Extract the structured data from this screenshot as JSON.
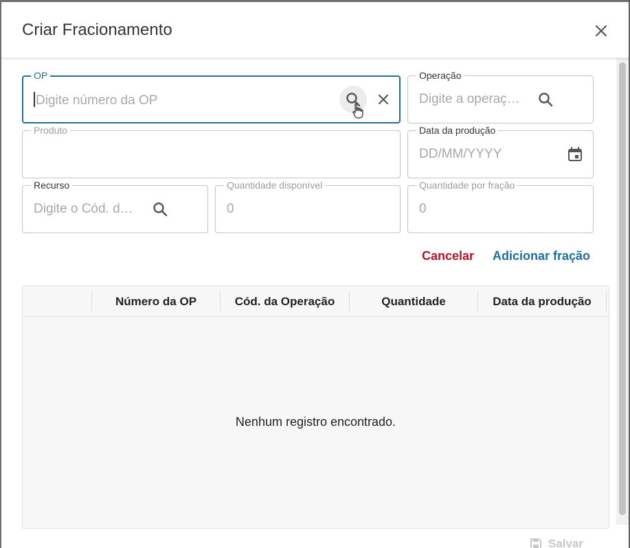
{
  "dialog": {
    "title": "Criar Fracionamento"
  },
  "form": {
    "op": {
      "label": "OP",
      "placeholder": "Digite número da OP"
    },
    "operacao": {
      "label": "Operação",
      "placeholder": "Digite a operaç…"
    },
    "produto": {
      "label": "Produto",
      "value": ""
    },
    "data_producao": {
      "label": "Data da produção",
      "placeholder": "DD/MM/YYYY"
    },
    "recurso": {
      "label": "Recurso",
      "placeholder": "Digite o Cód. d…"
    },
    "quantidade_disponivel": {
      "label": "Quantidade disponível",
      "value": "0"
    },
    "quantidade_por_fracao": {
      "label": "Quantidade por fração",
      "value": "0"
    }
  },
  "actions": {
    "cancel_label": "Cancelar",
    "add_label": "Adicionar fração"
  },
  "table": {
    "columns": [
      "",
      "Número da OP",
      "Cód. da Operação",
      "Quantidade",
      "Data da produção"
    ],
    "empty_message": "Nenhum registro encontrado."
  },
  "footer": {
    "save_label": "Salvar"
  },
  "colors": {
    "primary": "#1f6e9c",
    "danger": "#b3132b",
    "border": "#c4c4c4"
  },
  "icons": [
    "close-icon",
    "search-icon",
    "calendar-icon",
    "save-icon",
    "pointer-cursor-icon"
  ]
}
